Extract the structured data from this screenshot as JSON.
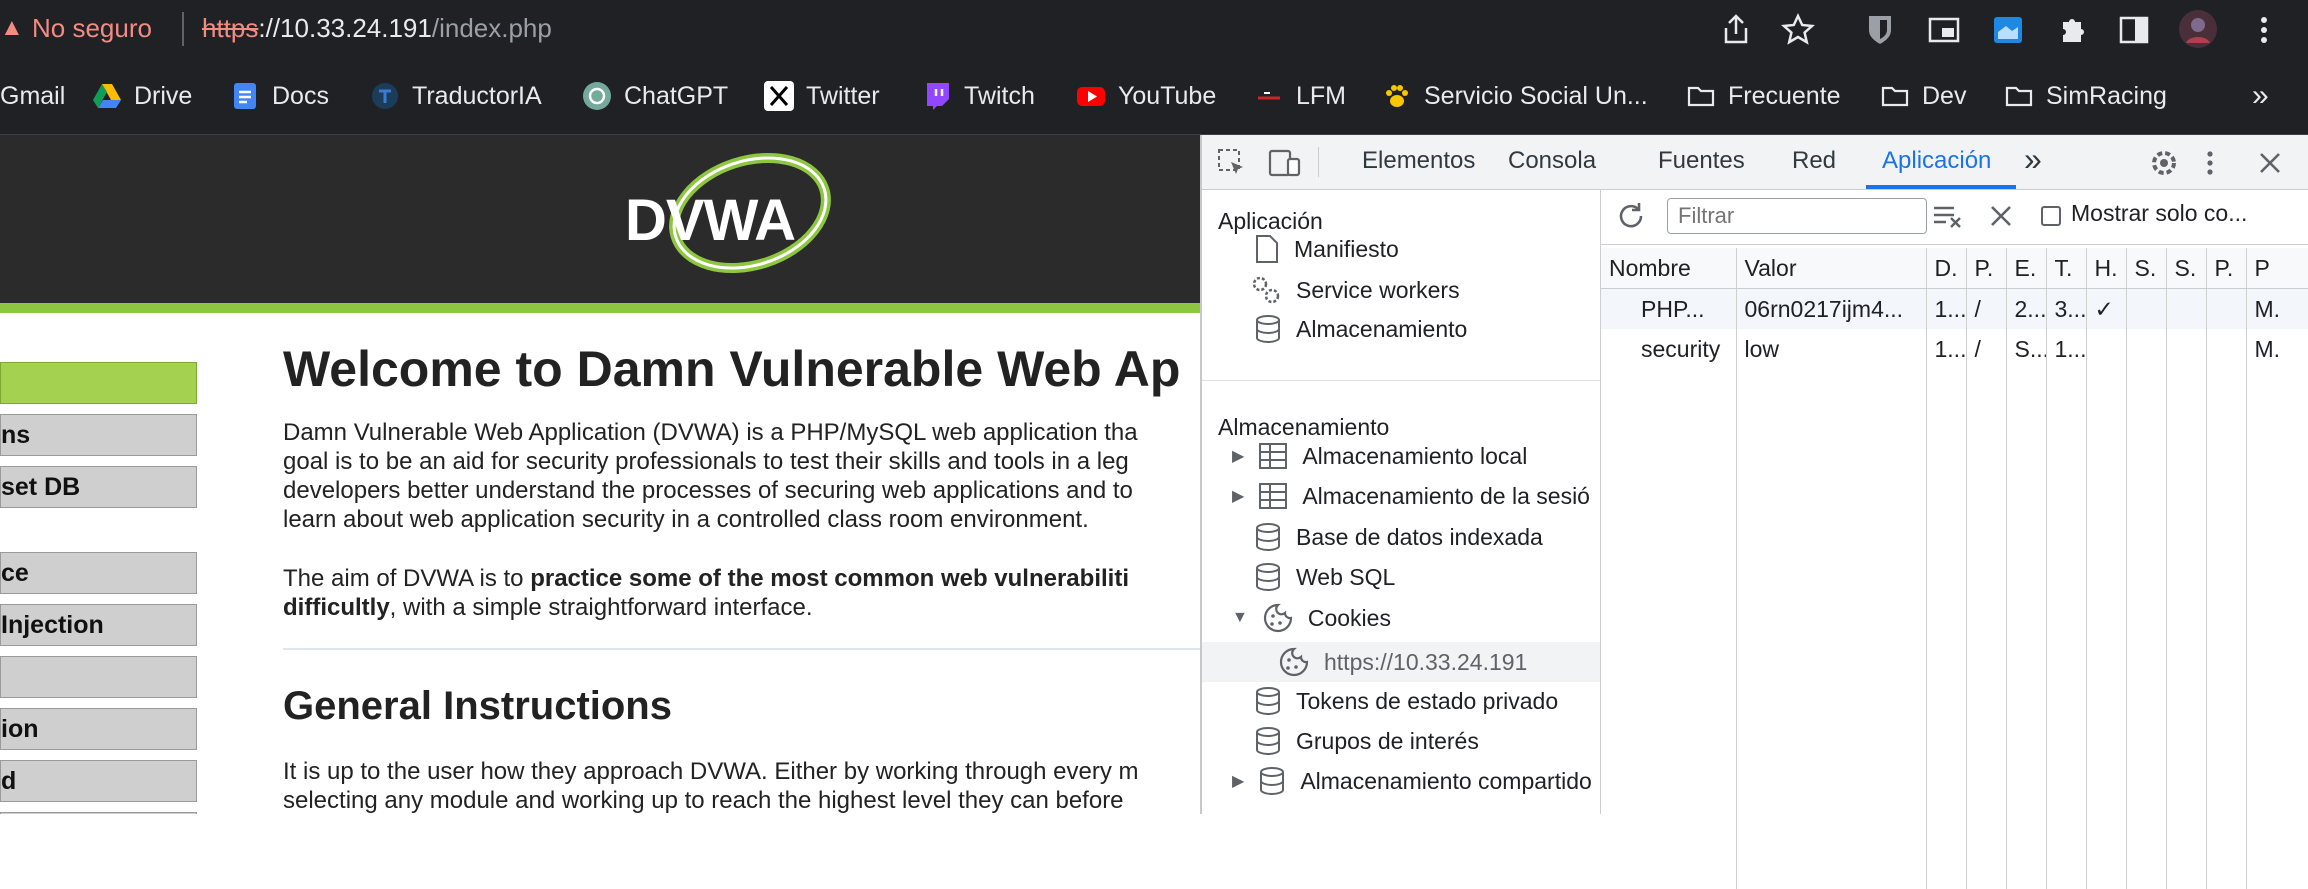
{
  "browser": {
    "security_label": "No seguro",
    "url_scheme": "https",
    "url_host": "://10.33.24.191",
    "url_path": "/index.php",
    "bookmarks": [
      {
        "label": "Gmail",
        "icon": "gmail-icon"
      },
      {
        "label": "Drive",
        "icon": "drive-icon"
      },
      {
        "label": "Docs",
        "icon": "docs-icon"
      },
      {
        "label": "TraductorIA",
        "icon": "traductoria-icon"
      },
      {
        "label": "ChatGPT",
        "icon": "chatgpt-icon"
      },
      {
        "label": "Twitter",
        "icon": "twitter-x-icon"
      },
      {
        "label": "Twitch",
        "icon": "twitch-icon"
      },
      {
        "label": "YouTube",
        "icon": "youtube-icon"
      },
      {
        "label": "LFM",
        "icon": "lfm-icon"
      },
      {
        "label": "Servicio Social Un...",
        "icon": "paw-icon"
      },
      {
        "label": "Frecuente",
        "icon": "folder-icon"
      },
      {
        "label": "Dev",
        "icon": "folder-icon"
      },
      {
        "label": "SimRacing",
        "icon": "folder-icon"
      }
    ],
    "more_bookmarks": "»"
  },
  "page": {
    "logo_text": "DVWA",
    "menu": [
      "",
      "ns",
      "set DB",
      "",
      "ce",
      " Injection",
      "",
      "ion",
      "d"
    ],
    "title": "Welcome to Damn Vulnerable Web Ap",
    "intro_lines": [
      "Damn Vulnerable Web Application (DVWA) is a PHP/MySQL web application tha",
      "goal is to be an aid for security professionals to test their skills and tools in a leg",
      "developers better understand the processes of securing web applications and to",
      "learn about web application security in a controlled class room environment."
    ],
    "aim_prefix": "The aim of DVWA is to ",
    "aim_bold": "practice some of the most common web vulnerabiliti",
    "aim_bold2": "difficultly",
    "aim_suffix": ", with a simple straightforward interface.",
    "section_title": "General Instructions",
    "general_lines": [
      "It is up to the user how they approach DVWA. Either by working through every m",
      "selecting any module and working up to reach the highest level they can before"
    ]
  },
  "devtools": {
    "tabs": [
      "Elementos",
      "Consola",
      "Fuentes",
      "Red",
      "Aplicación"
    ],
    "active_tab": "Aplicación",
    "more_tabs": "»",
    "sidebar": {
      "app_heading": "Aplicación",
      "app_items": [
        "Manifiesto",
        "Service workers",
        "Almacenamiento"
      ],
      "storage_heading": "Almacenamiento",
      "storage_items": [
        "Almacenamiento local",
        "Almacenamiento de la sesió",
        "Base de datos indexada",
        "Web SQL",
        "Cookies",
        "https://10.33.24.191",
        "Tokens de estado privado",
        "Grupos de interés",
        "Almacenamiento compartido"
      ]
    },
    "filter_placeholder": "Filtrar",
    "only_show_label": "Mostrar solo co...",
    "cookies_table": {
      "headers": [
        "Nombre",
        "Valor",
        "D.",
        "P.",
        "E.",
        "T.",
        "H.",
        "S.",
        "S.",
        "P.",
        "P"
      ],
      "rows": [
        [
          "PHP...",
          "06rn0217ijm4...",
          "1...",
          "/",
          "2...",
          "3...",
          "✓",
          "",
          "",
          "",
          "M."
        ],
        [
          "security",
          "low",
          "1...",
          "/",
          "S...",
          "1...",
          "",
          "",
          "",
          "",
          "M."
        ]
      ]
    }
  },
  "colors": {
    "chrome_bg": "#202124",
    "insecure": "#f28b82",
    "dvwa_green": "#8dc63f",
    "devtools_accent": "#1a73e8"
  }
}
